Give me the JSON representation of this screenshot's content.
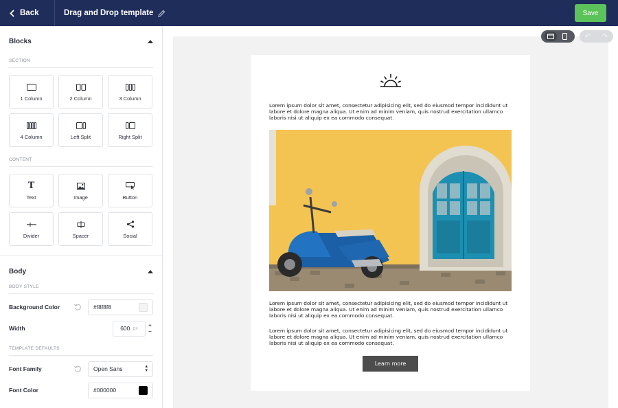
{
  "topbar": {
    "back_label": "Back",
    "template_title": "Drag and Drop template",
    "save_label": "Save",
    "colors": {
      "bar": "#1f2d5a",
      "save": "#5cc25a"
    }
  },
  "sidebar": {
    "blocks": {
      "title": "Blocks",
      "section_label": "SECTION",
      "section_items": [
        "1 Column",
        "2 Column",
        "3 Column",
        "4 Column",
        "Left Split",
        "Right Split"
      ],
      "content_label": "CONTENT",
      "content_items": [
        {
          "label": "Text",
          "icon": "text-icon"
        },
        {
          "label": "Image",
          "icon": "image-icon"
        },
        {
          "label": "Button",
          "icon": "button-icon"
        },
        {
          "label": "Divider",
          "icon": "divider-icon"
        },
        {
          "label": "Spacer",
          "icon": "spacer-icon"
        },
        {
          "label": "Social",
          "icon": "share-icon"
        }
      ]
    },
    "body": {
      "title": "Body",
      "style_label": "BODY STYLE",
      "background_color_label": "Background Color",
      "background_color_value": "#f8f8f8",
      "width_label": "Width",
      "width_value": "600",
      "width_unit": "px",
      "defaults_label": "TEMPLATE DEFAULTS",
      "font_family_label": "Font Family",
      "font_family_value": "Open Sans",
      "font_color_label": "Font Color",
      "font_color_value": "#000000"
    }
  },
  "email": {
    "paragraph_1": "Lorem ipsum dolor sit amet, consectetur adipisicing elit, sed do eiusmod tempor incididunt ut labore et dolore magna aliqua. Ut enim ad minim veniam, quis nostrud exercitation ullamco laboris nisi ut aliquip ex ea commodo consequat.",
    "paragraph_2": "Lorem ipsum dolor sit amet, consectetur adipisicing elit, sed do eiusmod tempor incididunt ut labore et dolore magna aliqua. Ut enim ad minim veniam, quis nostrud exercitation ullamco laboris nisi ut aliquip ex ea commodo consequat.",
    "paragraph_3": "Lorem ipsum dolor sit amet, consectetur adipisicing elit, sed do eiusmod tempor incididunt ut labore et dolore magna aliqua. Ut enim ad minim veniam, quis nostrud exercitation ullamco laboris nisi ut aliquip ex ea commodo consequat.",
    "button_label": "Learn more",
    "logo_icon": "sunrise-icon",
    "image_icon": "scooter-photo"
  },
  "toolbar": {
    "view_icons": [
      "desktop-icon",
      "mobile-icon"
    ],
    "history_icons": [
      "undo-icon",
      "redo-icon"
    ]
  }
}
